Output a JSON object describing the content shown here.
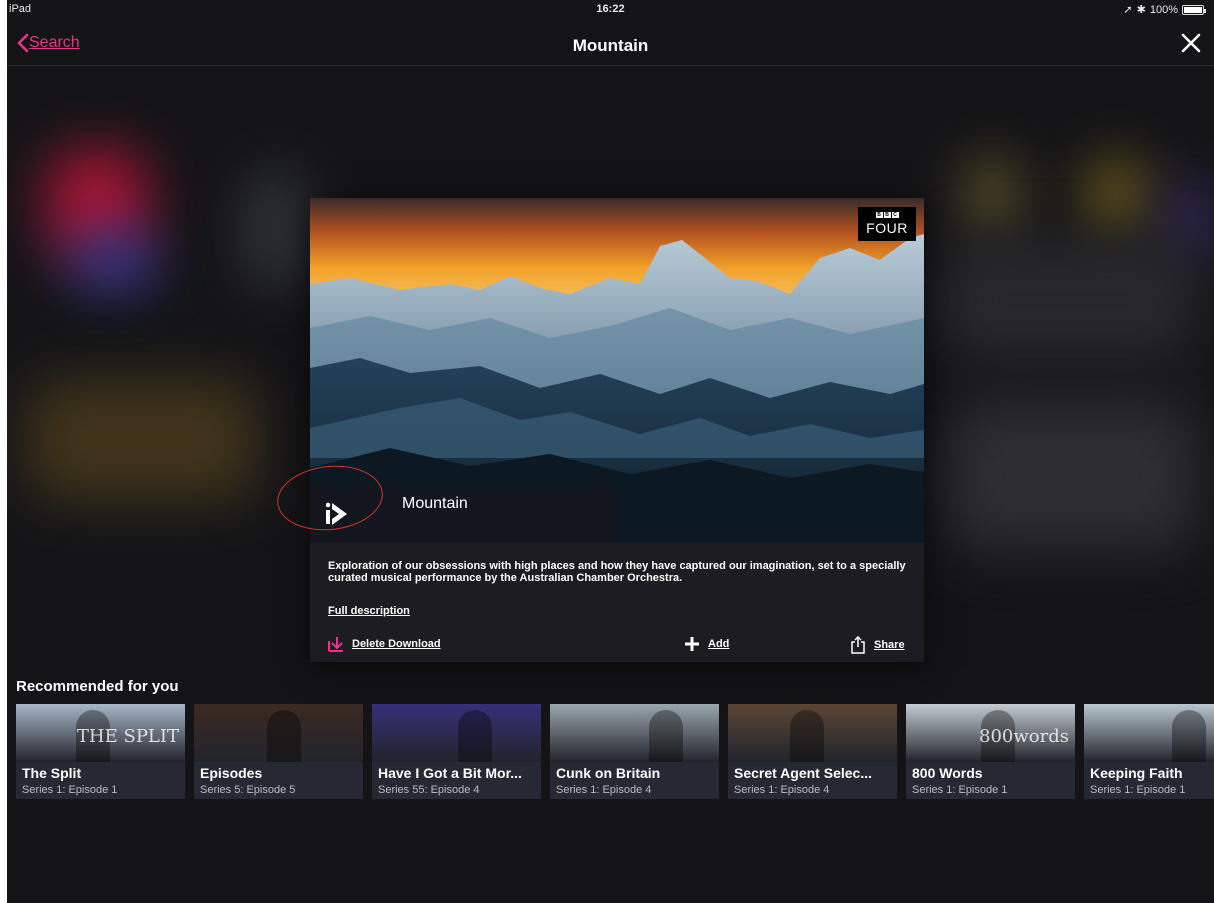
{
  "status_bar": {
    "device": "iPad",
    "time": "16:22",
    "battery": "100%",
    "battery_level": 1.0
  },
  "nav": {
    "back_label": "Search",
    "title": "Mountain"
  },
  "programme": {
    "channel": {
      "brand": "BBC",
      "name": "FOUR"
    },
    "title": "Mountain",
    "description": "Exploration of our obsessions with high places and how they have captured our imagination, set to a specially curated musical performance by the Australian Chamber Orchestra.",
    "full_description_link": "Full description",
    "actions": {
      "delete_download": "Delete Download",
      "add": "Add",
      "share": "Share"
    }
  },
  "recommended": {
    "heading": "Recommended for you",
    "items": [
      {
        "title": "The Split",
        "subtitle": "Series 1: Episode 1",
        "thumb_text": "THE SPLIT",
        "color": "#a8b6c8"
      },
      {
        "title": "Episodes",
        "subtitle": "Series 5: Episode 5",
        "thumb_text": "",
        "color": "#3b2a22"
      },
      {
        "title": "Have I Got a Bit Mor...",
        "subtitle": "Series 55: Episode 4",
        "thumb_text": "",
        "color": "#36307a"
      },
      {
        "title": "Cunk on Britain",
        "subtitle": "Series 1: Episode 4",
        "thumb_text": "",
        "color": "#9aa6ad"
      },
      {
        "title": "Secret Agent Selec...",
        "subtitle": "Series 1: Episode 4",
        "thumb_text": "",
        "color": "#5c4635"
      },
      {
        "title": "800 Words",
        "subtitle": "Series 1: Episode 1",
        "thumb_text": "800words",
        "color": "#c3ccd2"
      },
      {
        "title": "Keeping Faith",
        "subtitle": "Series 1: Episode 1",
        "thumb_text": "",
        "color": "#b8c6cf"
      }
    ]
  },
  "colors": {
    "accent": "#e5358b",
    "background": "#141417",
    "card": "#1c1c22",
    "annotation": "#d9352a"
  }
}
